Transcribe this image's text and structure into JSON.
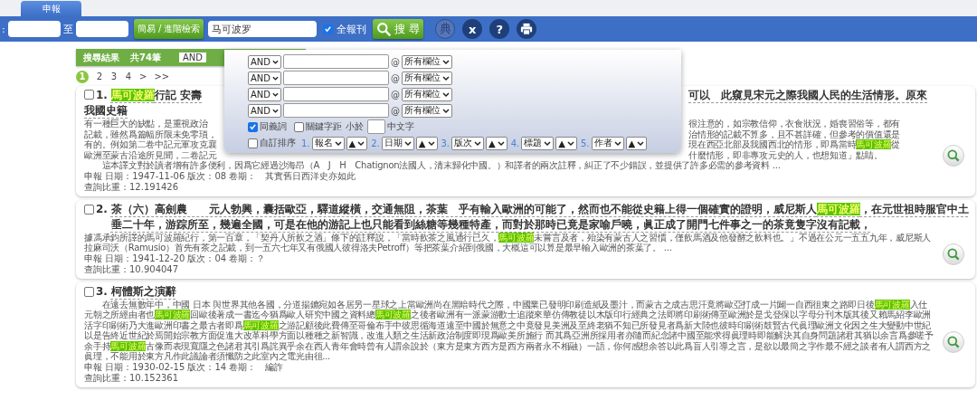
{
  "tabs": [
    {
      "label": "申報",
      "selected": true
    }
  ],
  "search_bar": {
    "date_label": ":",
    "date_separator": "至",
    "advanced_button": "簡易 / 進階檢索",
    "query": "马可波罗",
    "all_papers": {
      "label": "全報刊",
      "checked": true
    },
    "search_button": "搜 尋",
    "tool_icons": [
      "典",
      "x",
      "?"
    ]
  },
  "results_header": {
    "title": "搜尋結果",
    "count": "共74筆",
    "operator": "AND"
  },
  "pagination": [
    {
      "label": "1",
      "selected": true
    },
    {
      "label": "2",
      "selected": false
    },
    {
      "label": "3",
      "selected": false
    },
    {
      "label": "4",
      "selected": false
    },
    {
      "label": ">",
      "selected": false
    },
    {
      "label": ">>",
      "selected": false
    }
  ],
  "advanced_panel": {
    "rows": [
      {
        "operator": "AND",
        "at": "@",
        "field": "所有欄位"
      },
      {
        "operator": "AND",
        "at": "@",
        "field": "所有欄位"
      },
      {
        "operator": "AND",
        "at": "@",
        "field": "所有欄位"
      },
      {
        "operator": "AND",
        "at": "@",
        "field": "所有欄位"
      }
    ],
    "synonyms": {
      "label": "同義詞",
      "checked": true
    },
    "distance": {
      "label": "關鍵字距",
      "checked": false,
      "less_than": "小於",
      "unit": "中文字"
    },
    "custom_sort": {
      "label": "自訂排序",
      "checked": false,
      "keys": [
        {
          "number": "1.",
          "field": "報名",
          "order": "▲"
        },
        {
          "number": "2.",
          "field": "日期",
          "order": "▲"
        },
        {
          "number": "3.",
          "field": "版次",
          "order": "▲"
        },
        {
          "number": "4.",
          "field": "標題",
          "order": "▲"
        },
        {
          "number": "5.",
          "field": "作者",
          "order": "▲"
        }
      ]
    }
  },
  "results": [
    {
      "checked": false,
      "number": "1.",
      "title_lines": [
        {
          "parts": [
            [
              {
                "text": "馬可波羅",
                "highlighted": true
              },
              {
                "text": "行記 安壽",
                "highlighted": false
              }
            ],
            [
              {
                "text": "可以　此窺見宋元之際我國人民的生活情形。原來",
                "highlighted": false
              }
            ]
          ]
        },
        {
          "parts": [
            [
              {
                "text": "我國史籍",
                "highlighted": false
              }
            ]
          ]
        }
      ],
      "body_lines": [
        {
          "parts": [
            [
              {
                "text": "有一種巨大的缺點，是重視政治",
                "highlighted": false
              }
            ],
            [
              {
                "text": "很注意的，如宗教信仰，衣食狀況，婚喪習俗等，都有",
                "highlighted": false
              }
            ]
          ]
        },
        {
          "parts": [
            [
              {
                "text": "記載，雖然爲篇幅所限未免零瑣，",
                "highlighted": false
              }
            ],
            [
              {
                "text": "治情形的記載不算多，且不甚詳確，但參考的價值還是",
                "highlighted": false
              }
            ]
          ]
        },
        {
          "parts": [
            [
              {
                "text": "有的。例如第二卷中記元軍攻克襄",
                "highlighted": false
              }
            ],
            [
              {
                "text": "現在西亞北部及我國西北的情形，即爲當時",
                "highlighted": false
              },
              {
                "text": "馬可波羅",
                "highlighted": true
              },
              {
                "text": "從",
                "highlighted": false
              }
            ]
          ]
        },
        {
          "parts": [
            [
              {
                "text": "歐洲至蒙古沿途所見聞，二卷記元",
                "highlighted": false
              }
            ],
            [
              {
                "text": "什麼情形，即非專攻元史的人，也想知道」點睛。",
                "highlighted": false
              }
            ]
          ]
        },
        {
          "parts": [
            [
              {
                "text": "　　這本譯文對於讀者增有許多便利，因爲它經過沙海昂（A　J　H　Chatignon法國人，清末歸化中國。）和譯者的兩次註釋，糾正了不少錯誤，並提供了許多必需的參考資料 ...",
                "highlighted": false
              }
            ]
          ]
        }
      ],
      "meta": "申報 日期：1947-11-06 版次：08 卷期：　其實舊日西洋史亦如此",
      "score": "查詢比重：12.191426"
    },
    {
      "checked": false,
      "number": "2.",
      "title_lines": [
        {
          "parts": [
            [
              {
                "text": "茶（六）高劍農　　元人勃興，囊括歐亞，驛道縱橫，交通無阻，茶葉　乎有輸入歐洲的可能了，然而也不能從史籍上得一個確實的證明，威尼斯人",
                "highlighted": false
              },
              {
                "text": "馬可波羅",
                "highlighted": true
              },
              {
                "text": "，在元世祖時服官中土垂二十年，游踪所至，幾遍全國，可是在他的游記上也只能看到絲糖等幾種特產，而對於那時已竟是家喻戶曉，眞正成了開門七件事之一的茶竟隻字沒有記載，",
                "highlighted": false
              }
            ]
          ]
        }
      ],
      "body_lines": [
        {
          "parts": [
            [
              {
                "text": "據馮承鈞所譯的馬可波羅紀行，第一百章，「契丹人所飲之酒」條下的註釋說，「當時飲茶之風通行已久，",
                "highlighted": false
              },
              {
                "text": "馬可波羅",
                "highlighted": true
              },
              {
                "text": "未嘗言及者，殆染有蒙古人之習慣，僅飲馬酒及他發酵之飲料也。」不過在公元一五五九年，威尼斯人拉麻司沃（Ramusio）首先有茶之記載，到一五六七年又有俄國人彼得洛夫Petroff）等把茶葉介紹到俄國，大概這可以算是最早輸入歐洲的茶葉了。 ...",
                "highlighted": false
              }
            ]
          ]
        }
      ],
      "meta": "申報 日期：1941-12-20 版次：04 卷期：？",
      "score": "查詢比重：10.904047"
    },
    {
      "checked": false,
      "number": "3.",
      "title_lines": [
        {
          "parts": [
            [
              {
                "text": "柯體斯之演辭",
                "highlighted": false
              }
            ]
          ]
        }
      ],
      "body_lines": [
        {
          "parts": [
            [
              {
                "text": "　　在遠去無數年中，中國 日本 與世界其他各國，分道揚鑣宛如各居另一星球之上當歐洲尚在黑暗時代之際，中國業已發明印刷造紙及墨汁，而蒙古之成吉思汗竟將歐亞打成一片闢一自西徂東之路即日後",
                "highlighted": false
              },
              {
                "text": "馬可波羅",
                "highlighted": true
              },
              {
                "text": "入仕元朝之所經由者也",
                "highlighted": false
              },
              {
                "text": "馬可波羅",
                "highlighted": true
              },
              {
                "text": "回歐後著成一書迄今猶爲歐人研究中國之資料總",
                "highlighted": false
              },
              {
                "text": "馬可波羅",
                "highlighted": true
              },
              {
                "text": "之後者歐洲有一派蒙游歡士追蹤來華仿傳教徒以木版印行經典之法即將印刷術傳至歐洲於是戈登保以字母分刊木版其後又賴馬紹李歐洲活字印刷術乃大進歐洲印書之最古者即爲",
                "highlighted": false
              },
              {
                "text": "馬可波羅",
                "highlighted": true
              },
              {
                "text": "之游記顧後此費傳至哥倫布手中彼思循海道遠至中國於無意之中竟發見美洲及至終老猶不知已所發見者爲新大陸也彼時印刷術鼓賢古代眞理歐洲文化因之生大變動中世紀以是告終近世紀於焉開始宗教方面促進大改革科學方面以種種之新智識，改進人類之生活新政治制度即現爲歐美所施行 而其爲亞洲所採用者亦隨而紀念諸中國至能求得眞理時即能解決其自身問題諸君其猶以余言爲參嗟予余手持",
                "highlighted": false
              },
              {
                "text": "馬可波羅",
                "highlighted": true
              },
              {
                "text": "古像而表現寬隱之色諸君其引爲詫異乎余在西人青年會時曾有人謂余說於（東方是東方西方是西方兩者永不相融）一語，你何感想余答以此爲盲人引導之言，是欲以最簡之字作最不經之談者有人謂西方之眞理，不能用於東方凡作此議論者須懺防之此室內之電光由徂...",
                "highlighted": false
              }
            ]
          ]
        }
      ],
      "meta": "申報 日期：1930-02-15 版次：14 卷期：　編詐",
      "score": "查詢比重：10.152361"
    }
  ]
}
